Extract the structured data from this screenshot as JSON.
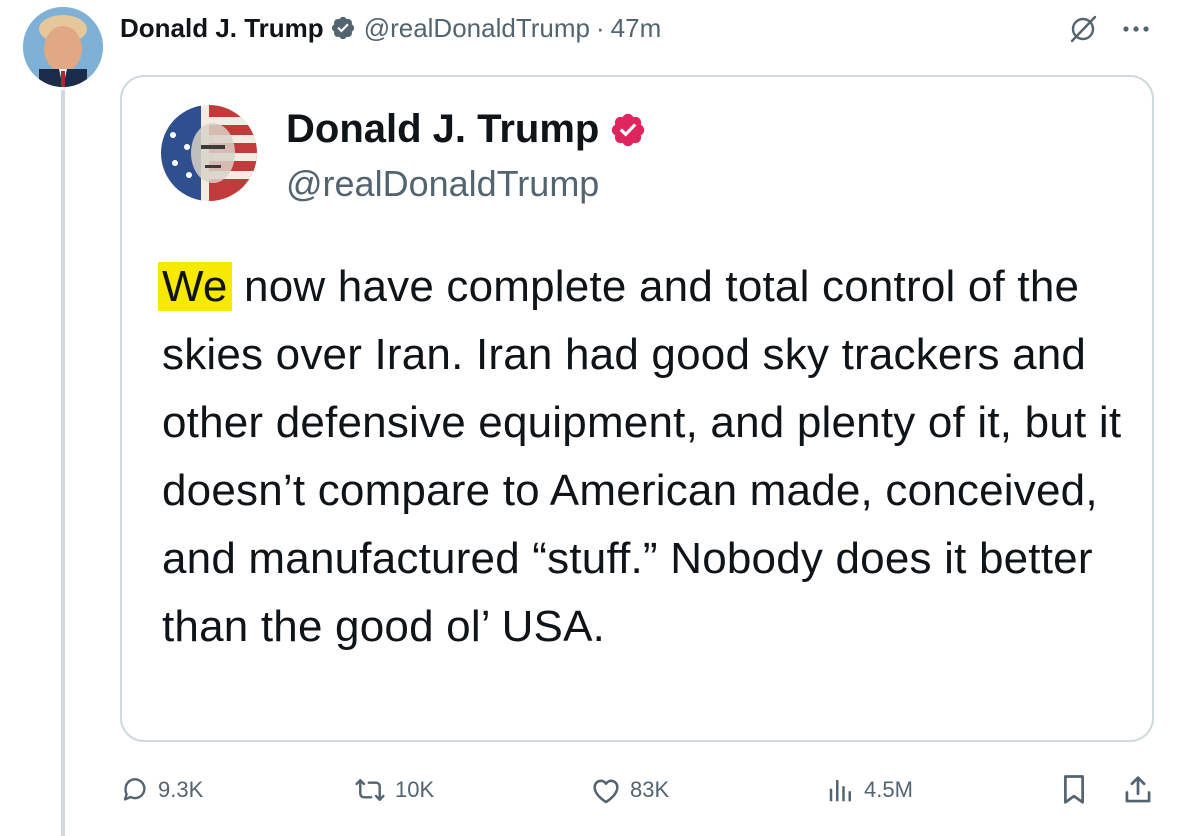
{
  "post": {
    "author_name": "Donald J. Trump",
    "handle": "@realDonaldTrump",
    "separator": "·",
    "time": "47m"
  },
  "quote": {
    "name": "Donald J. Trump",
    "handle": "@realDonaldTrump",
    "highlighted_word": "We",
    "body_rest": " now have complete and total control of the skies over Iran. Iran had good sky trackers and other defensive equipment, and plenty of it, but it doesn’t compare to American made, conceived, and manufactured “stuff.” Nobody does it better than the good ol’ USA."
  },
  "actions": {
    "replies": "9.3K",
    "reposts": "10K",
    "likes": "83K",
    "views": "4.5M"
  },
  "icons": [
    "verified-icon",
    "grok-icon",
    "more-icon",
    "reply-icon",
    "repost-icon",
    "like-icon",
    "views-icon",
    "bookmark-icon",
    "share-icon"
  ],
  "colors": {
    "verified_blue": "#536471",
    "quote_badge": "#e0245e",
    "highlight": "#f7ea00",
    "text_primary": "#0f1419",
    "text_secondary": "#536471",
    "border": "#cfd9de"
  }
}
